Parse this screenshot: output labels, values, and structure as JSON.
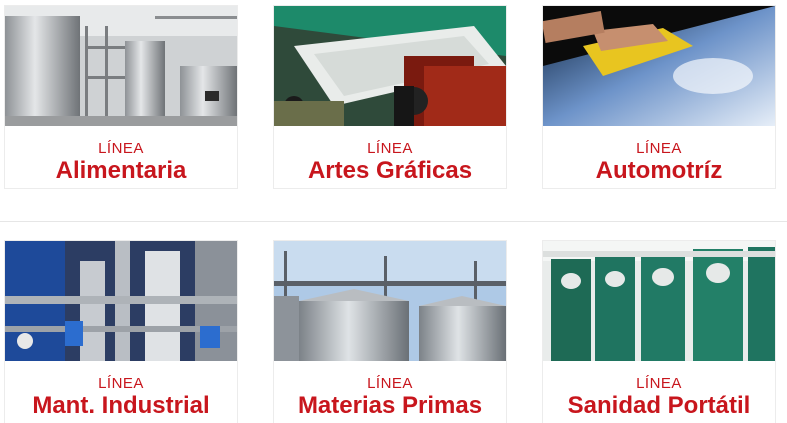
{
  "cards": [
    {
      "kicker": "LÍNEA",
      "title": "Alimentaria",
      "image": "food-processing-tanks-image"
    },
    {
      "kicker": "LÍNEA",
      "title": "Artes Gráficas",
      "image": "printing-press-image"
    },
    {
      "kicker": "LÍNEA",
      "title": "Automotríz",
      "image": "car-polishing-image"
    },
    {
      "kicker": "LÍNEA",
      "title": "Mant. Industrial",
      "image": "industrial-pipes-image"
    },
    {
      "kicker": "LÍNEA",
      "title": "Materias Primas",
      "image": "grain-silos-image"
    },
    {
      "kicker": "LÍNEA",
      "title": "Sanidad Portátil",
      "image": "portable-toilets-image"
    }
  ],
  "colors": {
    "accent": "#c8161d"
  }
}
